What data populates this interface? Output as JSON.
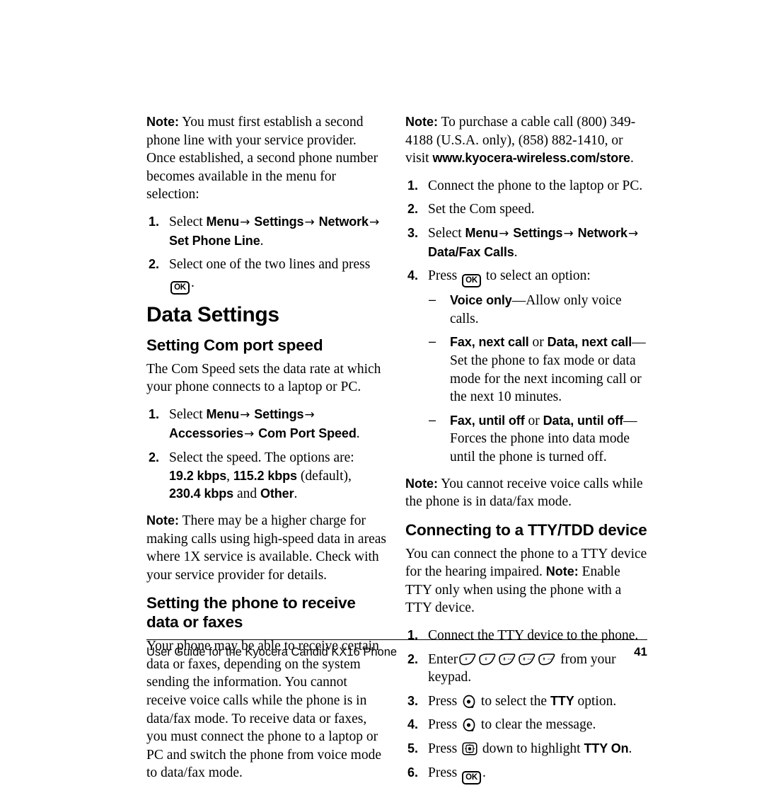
{
  "document": {
    "footer_text": "User Guide for the Kyocera Candid KX16 Phone",
    "page_number": "41"
  },
  "left_column": {
    "note_phone_line": {
      "label": "Note:",
      "text": "You must first establish a second phone line with your service provider. Once established, a second phone number becomes available in the menu for selection:"
    },
    "phone_line_steps": [
      {
        "num": "1.",
        "lead": "Select",
        "path": [
          "Menu",
          "Settings",
          "Network",
          "Set Phone Line"
        ],
        "trail": "."
      },
      {
        "num": "2.",
        "text_before": "Select one of the two lines and press",
        "key": "OK",
        "text_after": "."
      }
    ],
    "chapter_title": "Data Settings",
    "com_port_section": {
      "heading": "Setting Com port speed",
      "intro": "The Com Speed sets the data rate at which your phone connects to a laptop or PC.",
      "steps": [
        {
          "num": "1.",
          "lead": "Select",
          "path": [
            "Menu",
            "Settings",
            "Accessories",
            "Com Port Speed"
          ],
          "trail": "."
        },
        {
          "num": "2.",
          "text_before": "Select the speed. The options are:",
          "option1": "19.2 kbps",
          "sep1": ",",
          "option2": "115.2 kbps",
          "default_note": "(default),",
          "option3": "230.4 kbps",
          "conj": "and",
          "option4": "Other",
          "trail": "."
        }
      ]
    },
    "note_high_speed": {
      "label": "Note:",
      "text": "There may be a higher charge for making calls using high-speed data in areas where 1X service is available. Check with your service provider for details."
    },
    "receive_data_section": {
      "heading": "Setting the phone to receive data or faxes",
      "paragraph": "Your phone may be able to receive certain data or faxes, depending on the system sending the information. You cannot receive voice calls while the phone is in data/fax mode. To receive data or faxes, you must connect the phone to a laptop or PC and switch the phone from voice mode to data/fax mode."
    }
  },
  "right_column": {
    "note_cable": {
      "label": "Note:",
      "text_part1": "To purchase a cable call (800) 349-4188 (U.S.A. only), (858) 882-1410, or visit",
      "url": "www.kyocera-wireless.com/store",
      "trail": "."
    },
    "data_fax_steps": [
      {
        "num": "1.",
        "text": "Connect the phone to the laptop or PC."
      },
      {
        "num": "2.",
        "text": "Set the Com speed."
      },
      {
        "num": "3.",
        "lead": "Select",
        "path": [
          "Menu",
          "Settings",
          "Network",
          "Data/Fax Calls"
        ],
        "trail": "."
      },
      {
        "num": "4.",
        "text_before": "Press",
        "key": "OK",
        "text_after": "to select an option:"
      }
    ],
    "option_bullets": [
      {
        "dash": "–",
        "bold1": "Voice only",
        "emdash": "—",
        "rest": "Allow only voice calls."
      },
      {
        "dash": "–",
        "bold1": "Fax, next call",
        "conj": "or",
        "bold2": "Data, next call",
        "emdash": "—",
        "rest": "Set the phone to fax mode or data mode for the next incoming call or the next 10 minutes."
      },
      {
        "dash": "–",
        "bold1": "Fax, until off",
        "conj": "or",
        "bold2": "Data, until off",
        "emdash": "—",
        "rest": "Forces the phone into data mode until the phone is turned off."
      }
    ],
    "note_voice_calls": {
      "label": "Note:",
      "text": "You cannot receive voice calls while the phone is in data/fax mode."
    },
    "tty_section": {
      "heading": "Connecting to a TTY/TDD device",
      "intro_part1": "You can connect the phone to a TTY device for the hearing impaired.",
      "intro_note_label": "Note:",
      "intro_part2": "Enable TTY only when using the phone with a TTY device.",
      "steps": [
        {
          "num": "1.",
          "text": "Connect the TTY device to the phone."
        },
        {
          "num": "2.",
          "text_before": "Enter",
          "keys": [
            "#",
            "#",
            "8",
            "8",
            "9"
          ],
          "text_after": "from your keypad."
        },
        {
          "num": "3.",
          "text_before": "Press",
          "key": "select",
          "text_mid": "to select the",
          "bold": "TTY",
          "text_after": "option."
        },
        {
          "num": "4.",
          "text_before": "Press",
          "key": "select",
          "text_after": "to clear the message."
        },
        {
          "num": "5.",
          "text_before": "Press",
          "key": "navpad",
          "text_mid": "down to highlight",
          "bold": "TTY On",
          "text_after": "."
        },
        {
          "num": "6.",
          "text_before": "Press",
          "key": "OK",
          "text_after": "."
        }
      ]
    }
  },
  "icons": {
    "ok_key": "ok-key-icon",
    "select_key": "select-key-icon",
    "navpad_key": "navigation-pad-key-icon",
    "digit_key": "keypad-digit-key-icon"
  }
}
